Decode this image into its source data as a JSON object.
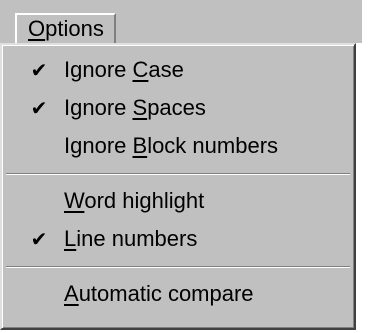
{
  "menu": {
    "title_mnemonic": "O",
    "title_rest": "ptions"
  },
  "groups": [
    [
      {
        "checked": true,
        "pre": "Ignore ",
        "mnemonic": "C",
        "post": "ase"
      },
      {
        "checked": true,
        "pre": "Ignore ",
        "mnemonic": "S",
        "post": "paces"
      },
      {
        "checked": false,
        "pre": "Ignore ",
        "mnemonic": "B",
        "post": "lock numbers"
      }
    ],
    [
      {
        "checked": false,
        "pre": "",
        "mnemonic": "W",
        "post": "ord highlight"
      },
      {
        "checked": true,
        "pre": "",
        "mnemonic": "L",
        "post": "ine numbers"
      }
    ],
    [
      {
        "checked": false,
        "pre": "",
        "mnemonic": "A",
        "post": "utomatic compare"
      }
    ]
  ],
  "check_glyph": "✔",
  "colors": {
    "face": "#c0c0c0",
    "shadow": "#808080",
    "highlight": "#ffffff",
    "text": "#000000"
  }
}
